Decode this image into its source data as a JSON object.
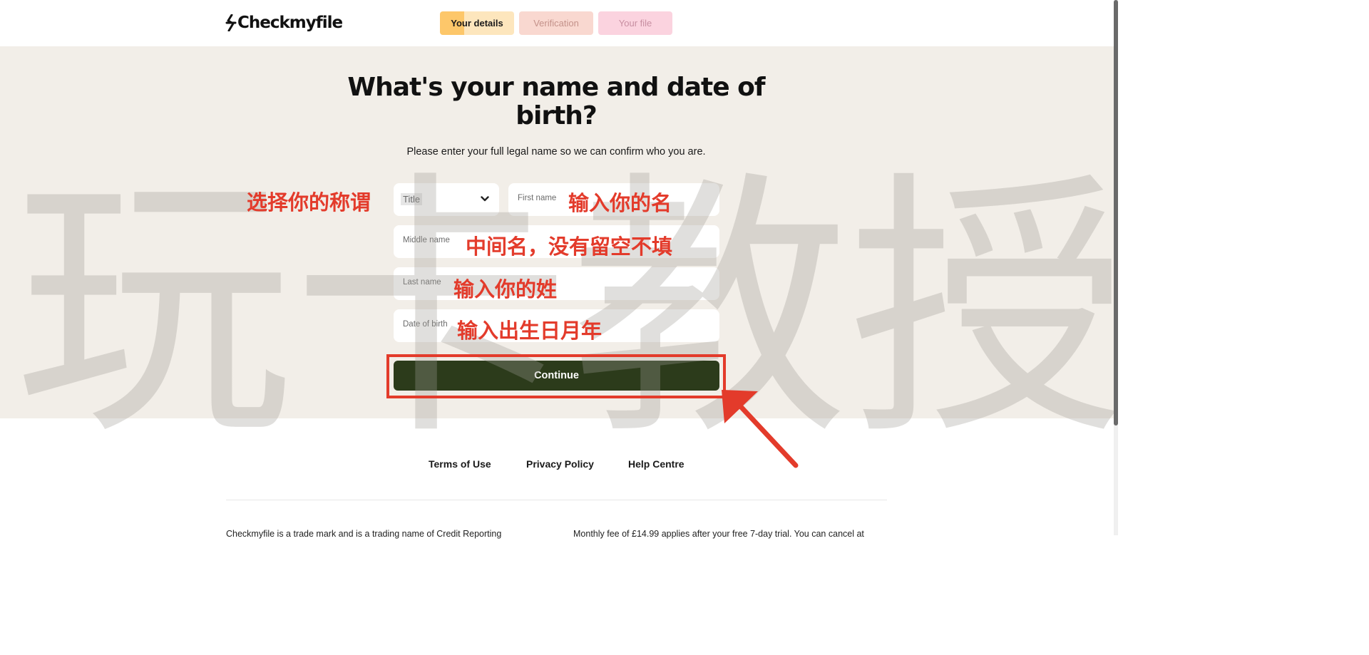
{
  "brand": {
    "name": "Checkmyfile",
    "logo_icon": "asterisk-logo-icon"
  },
  "steps": [
    {
      "label": "Your details",
      "state": "active"
    },
    {
      "label": "Verification",
      "state": "upcoming"
    },
    {
      "label": "Your file",
      "state": "upcoming"
    }
  ],
  "form": {
    "heading": "What's your name and date of birth?",
    "subheading": "Please enter your full legal name so we can confirm who you are.",
    "title_select": {
      "selected": "Title",
      "icon": "chevron-down-icon"
    },
    "fields": {
      "first_name": "First name",
      "middle_name": "Middle name",
      "last_name": "Last name",
      "date_of_birth": "Date of birth"
    },
    "continue_label": "Continue"
  },
  "footer": {
    "links": [
      "Terms of Use",
      "Privacy Policy",
      "Help Centre"
    ],
    "legal_left": "Checkmyfile is a trade mark and is a trading name of Credit Reporting",
    "legal_right": "Monthly fee of £14.99 applies after your free 7-day trial. You can cancel at"
  },
  "annotations": {
    "title": "选择你的称谓",
    "first_name": "输入你的名",
    "middle_name": "中间名，没有留空不填",
    "last_name": "输入你的姓",
    "dob": "输入出生日月年",
    "watermark": [
      "玩",
      "卡",
      "教",
      "授"
    ]
  },
  "colors": {
    "accent_button": "#2c3b1b",
    "step_active": "#fdc76a",
    "step_verification": "#f9d8d0",
    "step_file": "#fbd3df",
    "band": "#f2eee8",
    "annotation_red": "#e33b2b"
  }
}
